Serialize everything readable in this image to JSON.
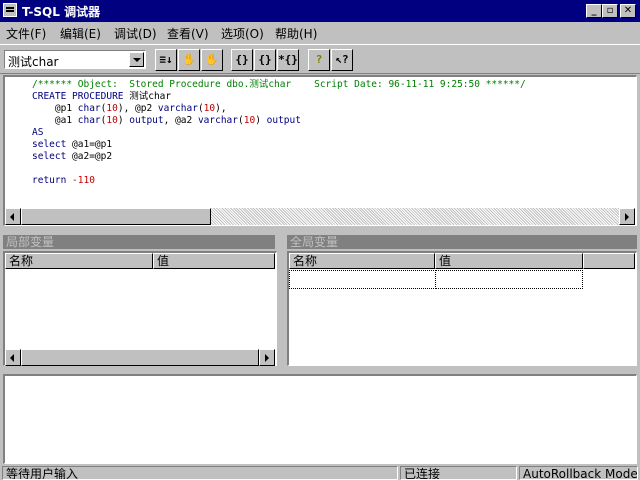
{
  "window": {
    "title": "T-SQL 调试器"
  },
  "menu": [
    "文件(F)",
    "编辑(E)",
    "调试(D)",
    "查看(V)",
    "选项(O)",
    "帮助(H)"
  ],
  "toolbar": {
    "procedure_select": "测试char",
    "buttons": [
      {
        "name": "step-list-button",
        "glyph": "≡↓"
      },
      {
        "name": "stop-hand-button",
        "glyph": "✋"
      },
      {
        "name": "breakpoint-hand-button",
        "glyph": "✋"
      },
      {
        "name": "step-into-button",
        "glyph": "{}"
      },
      {
        "name": "step-over-button",
        "glyph": "{}"
      },
      {
        "name": "step-out-button",
        "glyph": "*{}"
      },
      {
        "name": "help-button",
        "glyph": "?"
      },
      {
        "name": "context-help-button",
        "glyph": "↖?"
      }
    ]
  },
  "code_lines": [
    [
      {
        "t": "/****** Object:  Stored Procedure dbo.测试char    Script Date: 96-11-11 9:25:50 ******/",
        "c": "cm"
      }
    ],
    [
      {
        "t": "CREATE PROCEDURE ",
        "c": "kw"
      },
      {
        "t": "测试char",
        "c": ""
      }
    ],
    [
      {
        "t": "    @p1 ",
        "c": ""
      },
      {
        "t": "char",
        "c": "kw"
      },
      {
        "t": "(",
        "c": ""
      },
      {
        "t": "10",
        "c": "nu"
      },
      {
        "t": "), @p2 ",
        "c": ""
      },
      {
        "t": "varchar",
        "c": "kw"
      },
      {
        "t": "(",
        "c": ""
      },
      {
        "t": "10",
        "c": "nu"
      },
      {
        "t": "),",
        "c": ""
      }
    ],
    [
      {
        "t": "    @a1 ",
        "c": ""
      },
      {
        "t": "char",
        "c": "kw"
      },
      {
        "t": "(",
        "c": ""
      },
      {
        "t": "10",
        "c": "nu"
      },
      {
        "t": ") ",
        "c": ""
      },
      {
        "t": "output",
        "c": "kw"
      },
      {
        "t": ", @a2 ",
        "c": ""
      },
      {
        "t": "varchar",
        "c": "kw"
      },
      {
        "t": "(",
        "c": ""
      },
      {
        "t": "10",
        "c": "nu"
      },
      {
        "t": ") ",
        "c": ""
      },
      {
        "t": "output",
        "c": "kw"
      }
    ],
    [
      {
        "t": "AS",
        "c": "kw"
      }
    ],
    [
      {
        "t": "select ",
        "c": "kw"
      },
      {
        "t": "@a1=@p1",
        "c": ""
      }
    ],
    [
      {
        "t": "select ",
        "c": "kw"
      },
      {
        "t": "@a2=@p2",
        "c": ""
      }
    ],
    [
      {
        "t": "",
        "c": ""
      }
    ],
    [
      {
        "t": "return ",
        "c": "kw"
      },
      {
        "t": "-110",
        "c": "nu"
      }
    ]
  ],
  "local_vars": {
    "title": "局部变量",
    "col_name": "名称",
    "col_value": "值"
  },
  "global_vars": {
    "title": "全局变量",
    "col_name": "名称",
    "col_value": "值"
  },
  "status": {
    "left": "等待用户输入",
    "middle": "已连接",
    "right": "AutoRollback Mode"
  }
}
